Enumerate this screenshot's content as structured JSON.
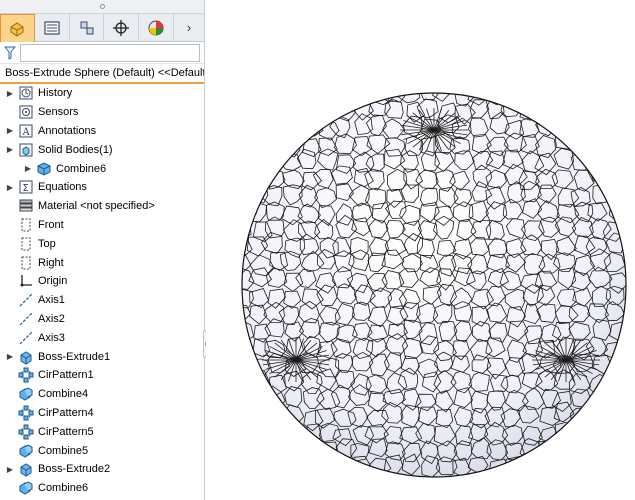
{
  "feature_tree": {
    "root_label": "Boss-Extrude Sphere (Default) <<Default",
    "tabs": [
      {
        "name": "feature-manager",
        "icon": "feature-manager-icon"
      },
      {
        "name": "property-manager",
        "icon": "property-manager-icon"
      },
      {
        "name": "configuration-manager",
        "icon": "configuration-manager-icon"
      },
      {
        "name": "dimxpert-manager",
        "icon": "crosshair-icon"
      },
      {
        "name": "display-manager",
        "icon": "appearance-icon"
      }
    ],
    "items": [
      {
        "label": "History",
        "icon": "history-icon",
        "expandable": true,
        "indent": 0
      },
      {
        "label": "Sensors",
        "icon": "sensor-icon",
        "expandable": false,
        "indent": 0
      },
      {
        "label": "Annotations",
        "icon": "annotations-icon",
        "expandable": true,
        "indent": 0
      },
      {
        "label": "Solid Bodies(1)",
        "icon": "solid-bodies-folder-icon",
        "expandable": true,
        "indent": 0
      },
      {
        "label": "Combine6",
        "icon": "solid-body-icon",
        "expandable": true,
        "indent": 1
      },
      {
        "label": "Equations",
        "icon": "equations-icon",
        "expandable": true,
        "indent": 0
      },
      {
        "label": "Material <not specified>",
        "icon": "material-icon",
        "expandable": false,
        "indent": 0
      },
      {
        "label": "Front",
        "icon": "plane-icon",
        "expandable": false,
        "indent": 0
      },
      {
        "label": "Top",
        "icon": "plane-icon",
        "expandable": false,
        "indent": 0
      },
      {
        "label": "Right",
        "icon": "plane-icon",
        "expandable": false,
        "indent": 0
      },
      {
        "label": "Origin",
        "icon": "origin-icon",
        "expandable": false,
        "indent": 0
      },
      {
        "label": "Axis1",
        "icon": "axis-icon",
        "expandable": false,
        "indent": 0
      },
      {
        "label": "Axis2",
        "icon": "axis-icon",
        "expandable": false,
        "indent": 0
      },
      {
        "label": "Axis3",
        "icon": "axis-icon",
        "expandable": false,
        "indent": 0
      },
      {
        "label": "Boss-Extrude1",
        "icon": "extrude-icon",
        "expandable": true,
        "indent": 0
      },
      {
        "label": "CirPattern1",
        "icon": "circular-pattern-icon",
        "expandable": false,
        "indent": 0
      },
      {
        "label": "Combine4",
        "icon": "combine-icon",
        "expandable": false,
        "indent": 0
      },
      {
        "label": "CirPattern4",
        "icon": "circular-pattern-icon",
        "expandable": false,
        "indent": 0
      },
      {
        "label": "CirPattern5",
        "icon": "circular-pattern-icon",
        "expandable": false,
        "indent": 0
      },
      {
        "label": "Combine5",
        "icon": "combine-icon",
        "expandable": false,
        "indent": 0
      },
      {
        "label": "Boss-Extrude2",
        "icon": "extrude-icon",
        "expandable": true,
        "indent": 0
      },
      {
        "label": "Combine6",
        "icon": "combine-icon",
        "expandable": false,
        "indent": 0
      }
    ]
  },
  "colors": {
    "active_tab": "#fbd38a",
    "accent_orange": "#f0a040",
    "sphere_fill": "#f4f5fb",
    "mesh_lines": "#1a1a1a",
    "body_icon_blue": "#3a8fd6"
  }
}
